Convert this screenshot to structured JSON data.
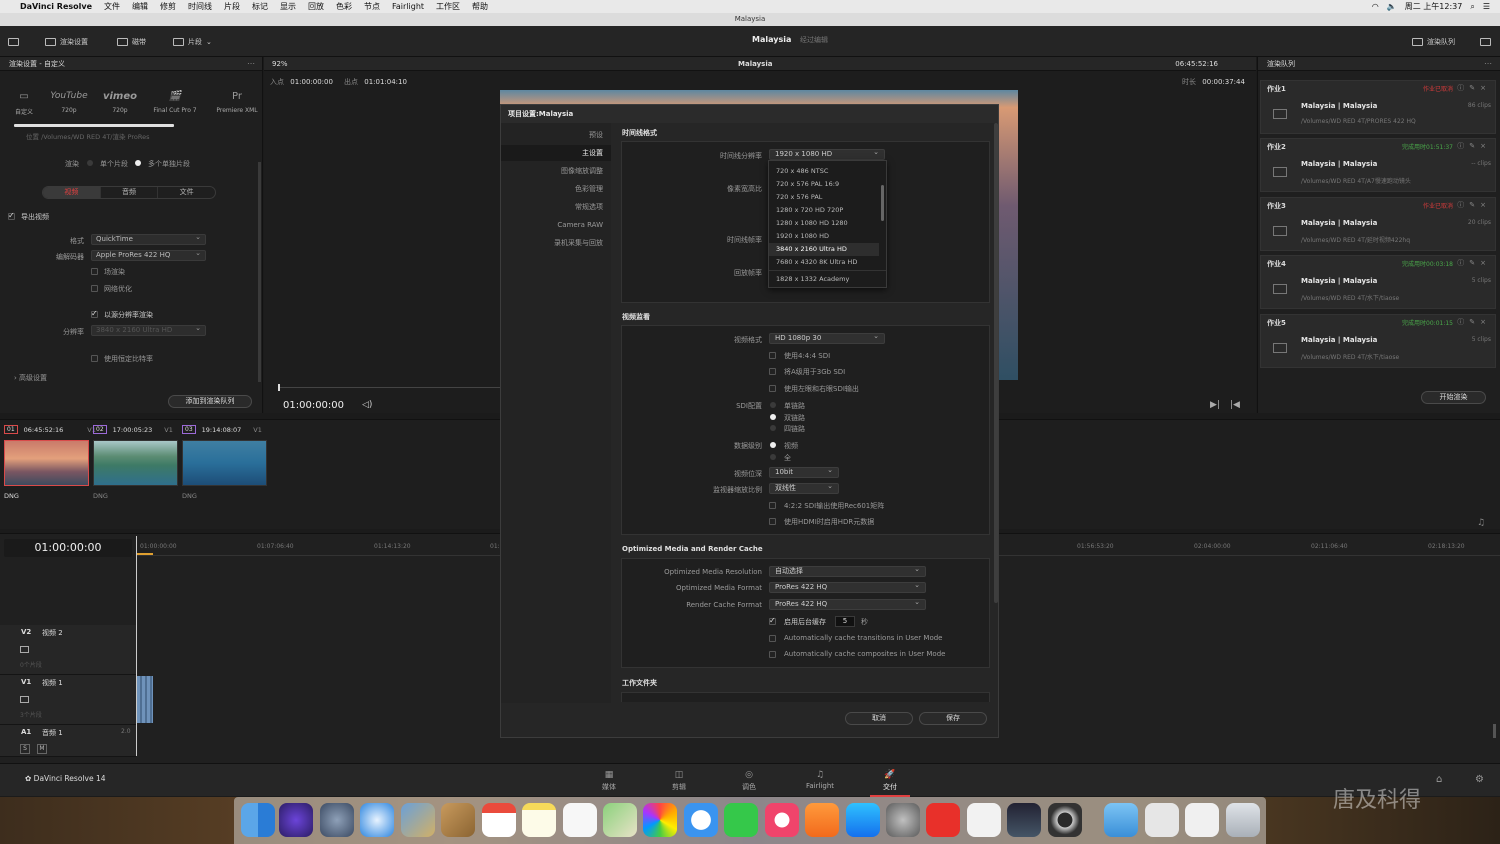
{
  "menubar": {
    "app": "DaVinci Resolve",
    "items": [
      "文件",
      "编辑",
      "修剪",
      "时间线",
      "片段",
      "标记",
      "显示",
      "回放",
      "色彩",
      "节点",
      "Fairlight",
      "工作区",
      "帮助"
    ],
    "clock": "周二 上午12:37"
  },
  "window_title": "Malaysia",
  "toolbar": {
    "render_settings": "渲染设置",
    "clip_label": "磁带",
    "clips_label": "片段",
    "project": "Malaysia",
    "edited": "经过编辑",
    "render_queue": "渲染队列"
  },
  "left": {
    "header": "渲染设置 - 自定义",
    "presets": [
      {
        "name": "自定义",
        "sub": "",
        "logo": "▭"
      },
      {
        "name": "720p",
        "sub": "",
        "logo": "YouTube"
      },
      {
        "name": "720p",
        "sub": "",
        "logo": "vimeo"
      },
      {
        "name": "Final Cut Pro 7",
        "sub": "",
        "logo": "🎬"
      },
      {
        "name": "Premiere XML",
        "sub": "",
        "logo": "Pr"
      }
    ],
    "path_text": "位置   /Volumes/WD RED 4T/渲染 ProRes",
    "render_label": "渲染",
    "single_clip": "单个片段",
    "multi_clip": "多个单独片段",
    "tabs": [
      "视频",
      "音频",
      "文件"
    ],
    "export_video": "导出视频",
    "format_label": "格式",
    "format_value": "QuickTime",
    "codec_label": "编解码器",
    "codec_value": "Apple ProRes 422 HQ",
    "proxy": "场渲染",
    "network": "网络优化",
    "source_res": "以源分辨率渲染",
    "res_label": "分辨率",
    "res_value": "3840 x 2160 Ultra HD",
    "fixed_ratio": "使用恒定比特率",
    "advanced": "高级设置",
    "add_queue": "添加到渲染队列"
  },
  "viewer": {
    "zoom": "92%",
    "title": "Malaysia",
    "tc_right": "06:45:52:16",
    "in_label": "入点",
    "in_tc": "01:00:00:00",
    "out_label": "出点",
    "out_tc": "01:01:04:10",
    "dur_label": "时长",
    "dur_tc": "00:00:37:44",
    "play_tc": "01:00:00:00"
  },
  "render_queue": {
    "header": "渲染队列",
    "jobs": [
      {
        "title": "作业1",
        "status": "作业已取消",
        "status_color": "#d23b3b",
        "name": "Malaysia | Malaysia",
        "clips": "86 clips",
        "path": "/Volumes/WD RED 4T/PRORES 422 HQ"
      },
      {
        "title": "作业2",
        "status": "完成用时01:51:37",
        "status_color": "#4aa84a",
        "name": "Malaysia | Malaysia",
        "clips": "-- clips",
        "path": "/Volumes/WD RED 4T/A7慢速跑动镜头"
      },
      {
        "title": "作业3",
        "status": "作业已取消",
        "status_color": "#d23b3b",
        "name": "Malaysia | Malaysia",
        "clips": "20 clips",
        "path": "/Volumes/WD RED 4T/延时视频422hq"
      },
      {
        "title": "作业4",
        "status": "完成用时00:03:18",
        "status_color": "#4aa84a",
        "name": "Malaysia | Malaysia",
        "clips": "5 clips",
        "path": "/Volumes/WD RED 4T/水下/tiaose"
      },
      {
        "title": "作业5",
        "status": "完成用时00:01:15",
        "status_color": "#4aa84a",
        "name": "Malaysia | Malaysia",
        "clips": "5 clips",
        "path": "/Volumes/WD RED 4T/水下/tiaose"
      }
    ],
    "start": "开始渲染"
  },
  "clips": [
    {
      "num": "01",
      "tc": "06:45:52:16",
      "track": "V1",
      "type": "DNG"
    },
    {
      "num": "02",
      "tc": "17:00:05:23",
      "track": "V1",
      "type": "DNG"
    },
    {
      "num": "03",
      "tc": "19:14:08:07",
      "track": "V1",
      "type": "DNG"
    }
  ],
  "timeline": {
    "tc": "01:00:00:00",
    "ruler": [
      "01:00:00:00",
      "01:07:06:40",
      "01:14:13:20",
      "01:2",
      "01:56:53:20",
      "02:04:00:00",
      "02:11:06:40",
      "02:18:13:20"
    ],
    "tracks": [
      {
        "id": "V2",
        "name": "视频 2",
        "count": "0个片段"
      },
      {
        "id": "V1",
        "name": "视频 1",
        "count": "3个片段"
      },
      {
        "id": "A1",
        "name": "音频 1",
        "count": "2.0"
      }
    ],
    "a1_buttons": [
      "S",
      "M"
    ]
  },
  "pages": {
    "brand": "DaVinci Resolve 14",
    "items": [
      {
        "label": "媒体",
        "icon": "▦"
      },
      {
        "label": "剪辑",
        "icon": "◫"
      },
      {
        "label": "调色",
        "icon": "◎"
      },
      {
        "label": "Fairlight",
        "icon": "♫"
      },
      {
        "label": "交付",
        "icon": "🚀"
      }
    ],
    "active": "交付"
  },
  "modal": {
    "title": "项目设置:Malaysia",
    "nav": [
      "预设",
      "主设置",
      "图像缩放调整",
      "色彩管理",
      "常规选项",
      "Camera RAW",
      "录机采集与回放"
    ],
    "nav_active": "主设置",
    "sec_timeline": "时间线格式",
    "timeline_res_label": "时间线分辨率",
    "timeline_res_value": "1920 x 1080 HD",
    "pixel_ratio_label": "像素宽高比",
    "framerate_label": "时间线帧率",
    "playback_label": "回放帧率",
    "dropdown_options": [
      "720 x 486 NTSC",
      "720 x 576 PAL 16:9",
      "720 x 576 PAL",
      "1280 x 720 HD 720P",
      "1280 x 1080 HD 1280",
      "1920 x 1080 HD",
      "3840 x 2160 Ultra HD",
      "7680 x 4320 8K Ultra HD",
      "1828 x 1332 Academy"
    ],
    "dropdown_selected": "3840 x 2160 Ultra HD",
    "sec_video": "视频监看",
    "video_format_label": "视频格式",
    "video_format_value": "HD 1080p 30",
    "opt_444": "使用4:4:4 SDI",
    "opt_3g": "将A级用于3Gb SDI",
    "opt_lr": "使用左眼和右眼SDI输出",
    "sdi_label": "SDI配置",
    "sdi_opts": [
      "单链路",
      "双链路",
      "四链路"
    ],
    "data_label": "数据级别",
    "data_opts": [
      "视频",
      "全"
    ],
    "bitdepth_label": "视频位深",
    "bitdepth_value": "10bit",
    "scaling_label": "监视器缩放比例",
    "scaling_value": "双线性",
    "rec601": "4:2:2 SDI输出使用Rec601矩阵",
    "hdr": "使用HDMI时启用HDR元数据",
    "sec_cache": "Optimized Media and Render Cache",
    "omr_label": "Optimized Media Resolution",
    "omr_value": "自动选择",
    "omf_label": "Optimized Media Format",
    "omf_value": "ProRes 422 HQ",
    "rcf_label": "Render Cache Format",
    "rcf_value": "ProRes 422 HQ",
    "bg_cache": "启用后台缓存",
    "bg_value": "5",
    "bg_unit": "秒",
    "auto_trans": "Automatically cache transitions in User Mode",
    "auto_comp": "Automatically cache composites in User Mode",
    "sec_work": "工作文件夹",
    "cancel": "取消",
    "save": "保存"
  },
  "watermark": "唐及科得"
}
